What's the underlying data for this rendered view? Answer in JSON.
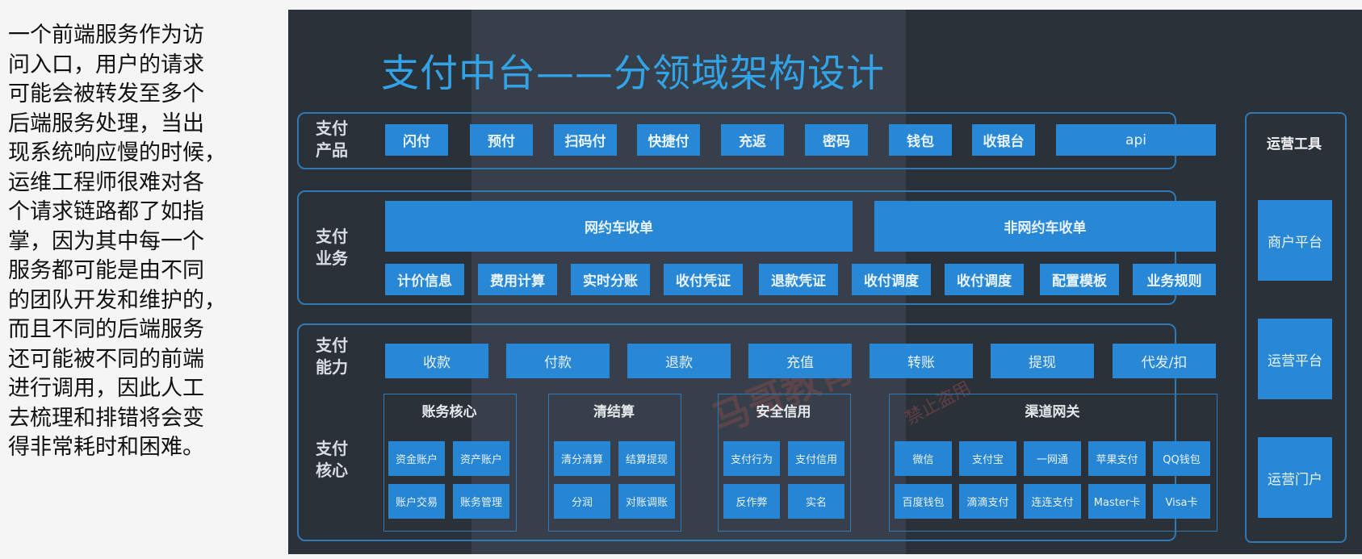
{
  "paragraph": [
    "一个前端服务作为访",
    "问入口，用户的请求",
    "可能会被转发至多个",
    "后端服务处理，当出",
    "现系统响应慢的时候，",
    "运维工程师很难对各",
    "个请求链路都了如指",
    "掌，因为其中每一个",
    "服务都可能是由不同",
    "的团队开发和维护的，",
    "而且不同的后端服务",
    "还可能被不同的前端",
    "进行调用，因此人工",
    "去梳理和排错将会变",
    "得非常耗时和困难。"
  ],
  "diagram": {
    "title": "支付中台——分领域架构设计",
    "products": {
      "label_line1": "支付",
      "label_line2": "产品",
      "items": [
        "闪付",
        "预付",
        "扫码付",
        "快捷付",
        "充返",
        "密码",
        "钱包",
        "收银台",
        "api"
      ]
    },
    "business": {
      "label_line1": "支付",
      "label_line2": "业务",
      "top": [
        "网约车收单",
        "非网约车收单"
      ],
      "items": [
        "计价信息",
        "费用计算",
        "实时分账",
        "收付凭证",
        "退款凭证",
        "收付调度",
        "收付调度",
        "配置模板",
        "业务规则"
      ]
    },
    "capability": {
      "label_line1": "支付",
      "label_line2": "能力",
      "items": [
        "收款",
        "付款",
        "退款",
        "充值",
        "转账",
        "提现",
        "代发/扣"
      ]
    },
    "core": {
      "label_line1": "支付",
      "label_line2": "核心",
      "groups": [
        {
          "title": "账务核心",
          "items": [
            "资金账户",
            "资产账户",
            "账户交易",
            "账务管理"
          ]
        },
        {
          "title": "清结算",
          "items": [
            "清分清算",
            "结算提现",
            "分润",
            "对账调账"
          ]
        },
        {
          "title": "安全信用",
          "items": [
            "支付行为",
            "支付信用",
            "反作弊",
            "实名"
          ]
        },
        {
          "title": "渠道网关",
          "items": [
            "微信",
            "支付宝",
            "一网通",
            "苹果支付",
            "QQ钱包",
            "百度钱包",
            "滴滴支付",
            "连连支付",
            "Master卡",
            "Visa卡"
          ]
        }
      ]
    },
    "ops": {
      "title": "运营工具",
      "items": [
        "商户平台",
        "运营平台",
        "运营门户"
      ]
    },
    "watermark": [
      "禁止盗用",
      "马哥教育"
    ]
  }
}
